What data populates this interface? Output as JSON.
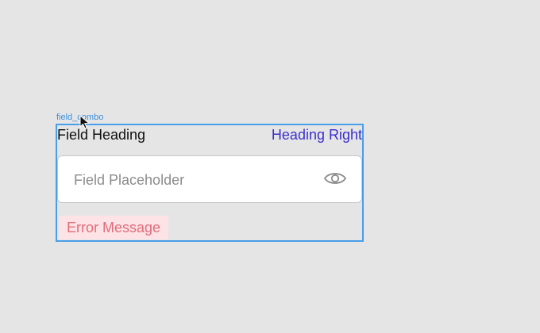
{
  "frame": {
    "label": "field_combo"
  },
  "field": {
    "heading": "Field Heading",
    "heading_right": "Heading Right",
    "placeholder": "Field Placeholder",
    "error_message": "Error Message",
    "trailing_icon": "eye-icon"
  },
  "colors": {
    "canvas": "#e5e5e5",
    "selection": "#4a9ee8",
    "heading_right": "#3b2fcf",
    "error_text": "#e06d7c",
    "error_bg": "#fde3e5"
  }
}
